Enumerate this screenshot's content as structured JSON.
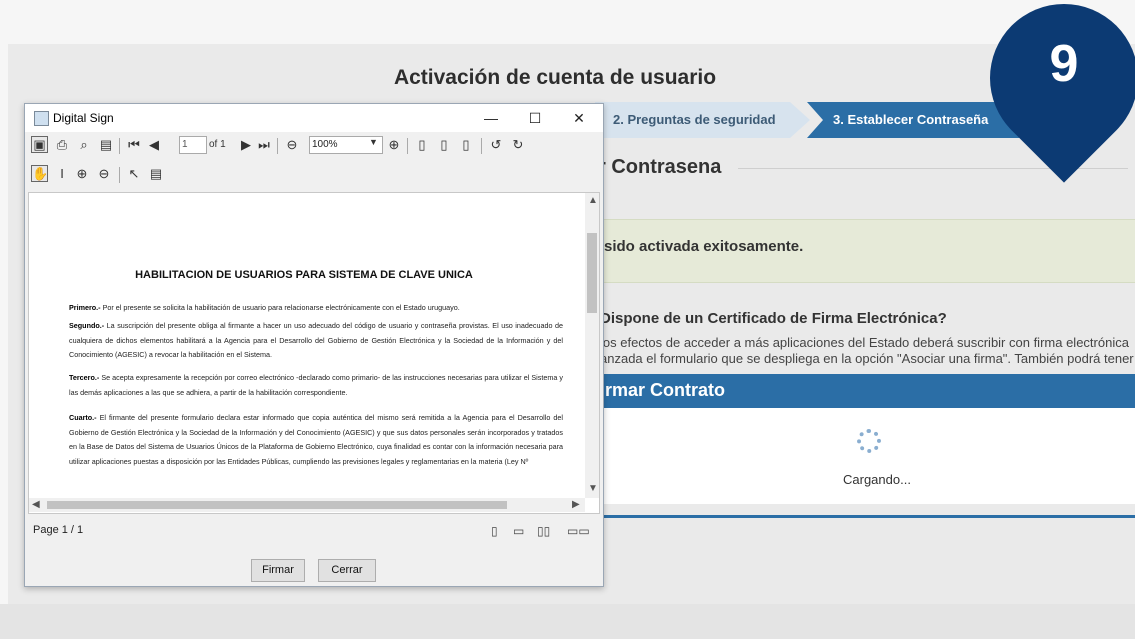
{
  "page": {
    "title": "Activación de cuenta de usuario",
    "steps": [
      "2. Preguntas de seguridad",
      "3. Establecer Contraseña"
    ],
    "section_title": "r Contrasena",
    "success_message": "sido activada exitosamente.",
    "question": "Dispone de un Certificado de Firma Electrónica?",
    "info_line1": "los efectos de acceder a más aplicaciones del Estado deberá suscribir con firma electrónica",
    "info_line2": "anzada el formulario que se despliega en la opción \"Asociar una firma\". También podrá tener",
    "modal_title": "rmar Contrato",
    "loading_text": "Cargando..."
  },
  "badge": {
    "number": "9",
    "color": "#0c3a73"
  },
  "window": {
    "title": "Digital Sign",
    "page_input": "1",
    "page_of": "of 1",
    "zoom": "100%",
    "status_page": "Page 1 / 1",
    "buttons": {
      "sign": "Firmar",
      "close": "Cerrar"
    }
  },
  "document": {
    "title": "HABILITACION DE USUARIOS PARA SISTEMA DE CLAVE UNICA",
    "paragraphs": [
      {
        "heading": "Primero.-",
        "text": "Por el presente se solicita la habilitación de usuario para relacionarse electrónicamente con el Estado uruguayo."
      },
      {
        "heading": "Segundo.-",
        "text": "La suscripción del presente obliga al firmante a hacer un uso adecuado del código de usuario y contraseña provistas. El uso inadecuado de cualquiera de dichos elementos habilitará a la Agencia para el Desarrollo del Gobierno de Gestión Electrónica y la Sociedad de la Información y del Conocimiento (AGESIC) a revocar la habilitación en el Sistema."
      },
      {
        "heading": "Tercero.-",
        "text": "Se acepta expresamente la recepción por correo electrónico -declarado como primario- de las instrucciones necesarias para utilizar el Sistema y las demás aplicaciones a las que se adhiera, a partir de la habilitación correspondiente."
      },
      {
        "heading": "Cuarto.-",
        "text": "El firmante del presente formulario declara estar informado que copia auténtica del mismo será remitida a la Agencia para el Desarrollo del Gobierno de Gestión Electrónica y la Sociedad de la Información y del Conocimiento (AGESIC) y que sus datos personales serán incorporados y tratados en la Base de Datos del Sistema de Usuarios Únicos de la Plataforma de Gobierno Electrónico, cuya finalidad es contar con la información necesaria para utilizar aplicaciones puestas a disposición por las Entidades Públicas, cumpliendo las previsiones legales y reglamentarias en la materia (Ley Nº"
      }
    ]
  },
  "colors": {
    "accent": "#2b6ea6",
    "step_inactive": "#d7e3ee",
    "success_bg": "#e6ead8"
  }
}
